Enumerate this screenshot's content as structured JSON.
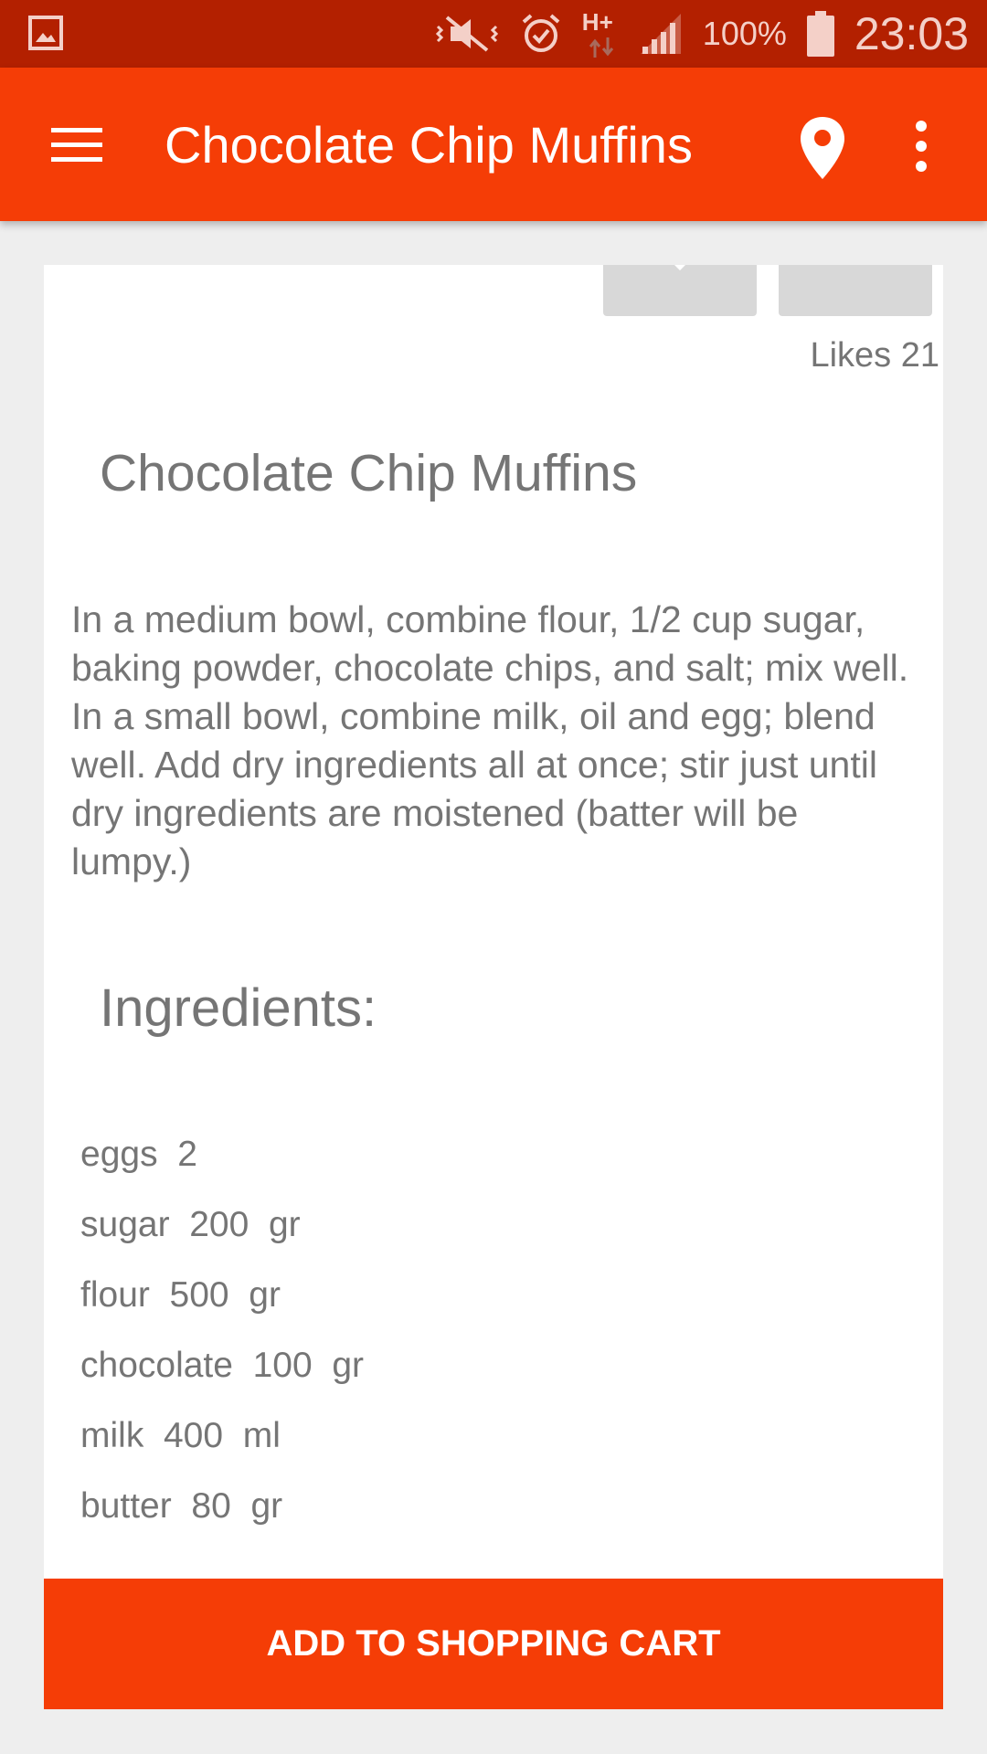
{
  "status_bar": {
    "battery_percent": "100%",
    "time": "23:03",
    "network_label": "H+",
    "icons": [
      "gallery-icon",
      "mute-vibrate-icon",
      "alarm-icon",
      "network-icon",
      "signal-icon",
      "battery-icon"
    ]
  },
  "app_bar": {
    "title": "Chocolate Chip Muffins",
    "icons": [
      "menu-icon",
      "location-pin-icon",
      "more-vert-icon"
    ]
  },
  "recipe": {
    "likes": "Likes 21",
    "title": "Chocolate Chip Muffins",
    "description": "In a medium bowl, combine flour, 1/2 cup sugar, baking powder, chocolate chips, and salt; mix well. In a small bowl, combine milk, oil and egg; blend well. Add dry ingredients all at once; stir just until dry ingredients are moistened (batter will be lumpy.)",
    "ingredients_heading": "Ingredients:",
    "ingredients": [
      {
        "text": "eggs  2"
      },
      {
        "text": "sugar  200  gr"
      },
      {
        "text": "flour  500  gr"
      },
      {
        "text": "chocolate  100  gr"
      },
      {
        "text": "milk  400  ml"
      },
      {
        "text": "butter  80  gr"
      }
    ]
  },
  "cart_button": {
    "label": "ADD TO SHOPPING CART"
  },
  "colors": {
    "accent": "#f53d06",
    "status_bar": "#b32000",
    "text_gray": "#757575"
  }
}
